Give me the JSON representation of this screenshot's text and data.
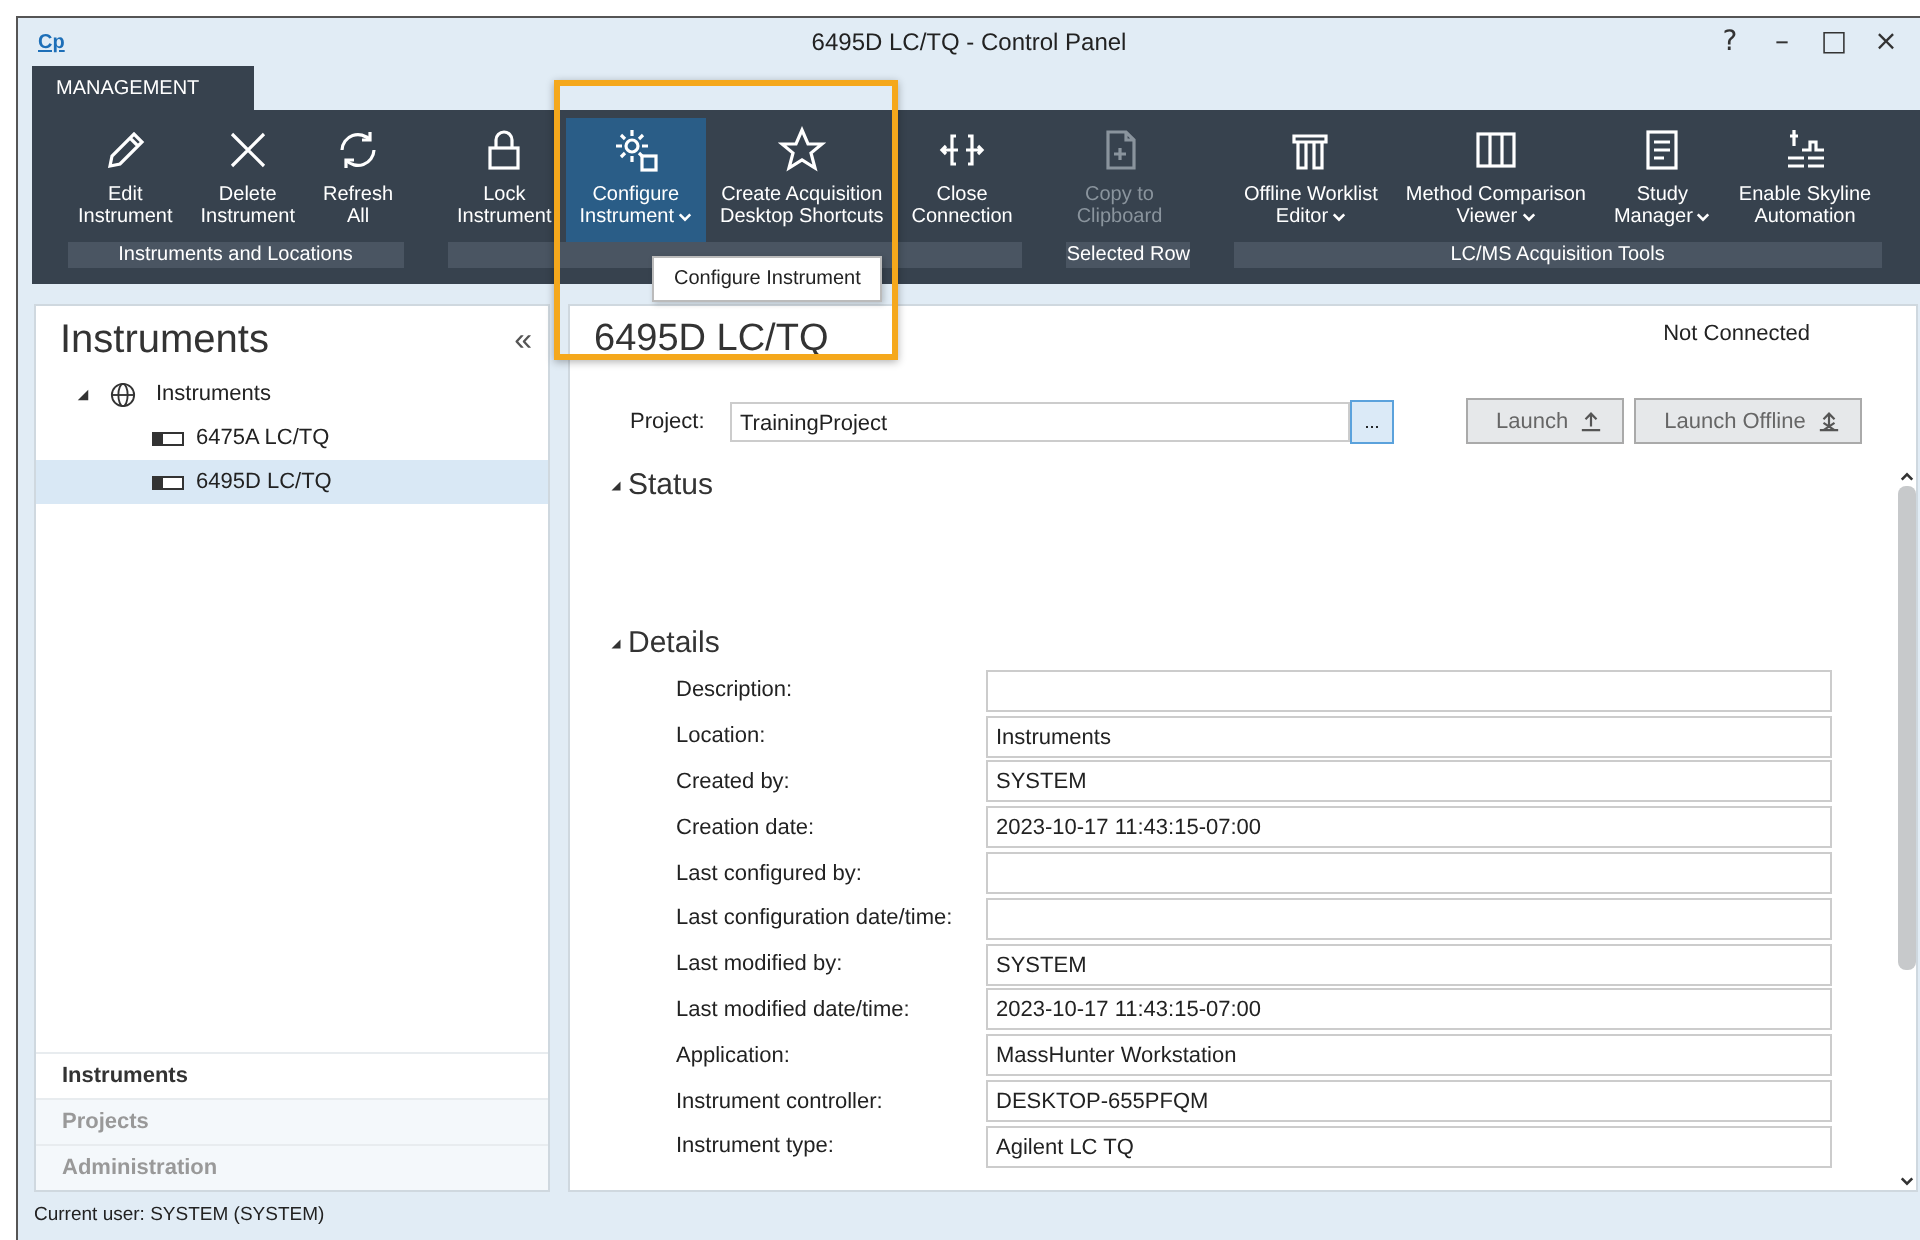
{
  "window": {
    "logo": "Cp",
    "title": "6495D LC/TQ - Control Panel",
    "controls": [
      "?",
      "–",
      "□",
      "×"
    ]
  },
  "tabs": [
    {
      "label": "MANAGEMENT",
      "selected": true
    }
  ],
  "ribbon": {
    "groups": [
      {
        "label": "Instruments and Locations",
        "buttons": [
          {
            "label": "Edit\nInstrument",
            "dropdown": false,
            "selected": false,
            "disabled": false
          },
          {
            "label": "Delete\nInstrument",
            "dropdown": false,
            "selected": false,
            "disabled": false
          },
          {
            "label": "Refresh\nAll",
            "dropdown": false,
            "selected": false,
            "disabled": false
          }
        ]
      },
      {
        "buttons": [
          {
            "label": "Lock\nInstrument",
            "dropdown": false,
            "selected": false,
            "disabled": false
          },
          {
            "label": "Configure\nInstrument",
            "dropdown": true,
            "selected": true,
            "disabled": false
          },
          {
            "label": "Create Acquisition\nDesktop Shortcuts",
            "dropdown": false,
            "selected": false,
            "disabled": false
          },
          {
            "label": "Close\nConnection",
            "dropdown": false,
            "selected": false,
            "disabled": false
          }
        ]
      },
      {
        "label": "Selected Row",
        "buttons": [
          {
            "label": "Copy to\nClipboard",
            "dropdown": false,
            "selected": false,
            "disabled": true
          }
        ]
      },
      {
        "label": "LC/MS Acquisition Tools",
        "buttons": [
          {
            "label": "Offline Worklist\nEditor",
            "dropdown": true,
            "selected": false,
            "disabled": false
          },
          {
            "label": "Method Comparison\nViewer",
            "dropdown": true,
            "selected": false,
            "disabled": false
          },
          {
            "label": "Study\nManager",
            "dropdown": true,
            "selected": false,
            "disabled": false
          },
          {
            "label": "Enable Skyline\nAutomation",
            "dropdown": false,
            "selected": false,
            "disabled": false
          }
        ]
      }
    ]
  },
  "tooltip": "Configure Instrument",
  "highlight_frame": true,
  "sidebar": {
    "title": "Instruments",
    "collapse": "«",
    "tree": [
      {
        "label": "Instruments",
        "expanded": true,
        "selected": false,
        "children": [
          {
            "label": "6475A LC/TQ",
            "selected": false
          },
          {
            "label": "6495D LC/TQ",
            "selected": true
          }
        ]
      }
    ],
    "nav": [
      {
        "label": "Instruments",
        "selected": true
      },
      {
        "label": "Projects",
        "selected": false
      },
      {
        "label": "Administration",
        "selected": false
      }
    ]
  },
  "detail": {
    "title": "6495D LC/TQ",
    "connection": "Not Connected",
    "project_label": "Project:",
    "project_value": "TrainingProject",
    "browse": "...",
    "launch_buttons": [
      "Launch",
      "Launch Offline"
    ],
    "sections": [
      {
        "title": "Status",
        "expanded": true
      },
      {
        "title": "Details",
        "expanded": true,
        "fields": [
          {
            "label": "Description:"
          },
          {
            "label": "Location:",
            "value": "Instruments"
          },
          {
            "label": "Created by:",
            "value": "SYSTEM"
          },
          {
            "label": "Creation date:",
            "value": "2023-10-17 11:43:15-07:00"
          },
          {
            "label": "Last configured by:"
          },
          {
            "label": "Last configuration date/time:"
          },
          {
            "label": "Last modified by:",
            "value": "SYSTEM"
          },
          {
            "label": "Last modified date/time:",
            "value": "2023-10-17 11:43:15-07:00"
          },
          {
            "label": "Application:",
            "value": "MassHunter Workstation"
          },
          {
            "label": "Instrument controller:",
            "value": "DESKTOP-655PFQM"
          },
          {
            "label": "Instrument type:",
            "value": "Agilent LC TQ"
          }
        ]
      }
    ]
  },
  "status_bar": "Current user: SYSTEM (SYSTEM)"
}
